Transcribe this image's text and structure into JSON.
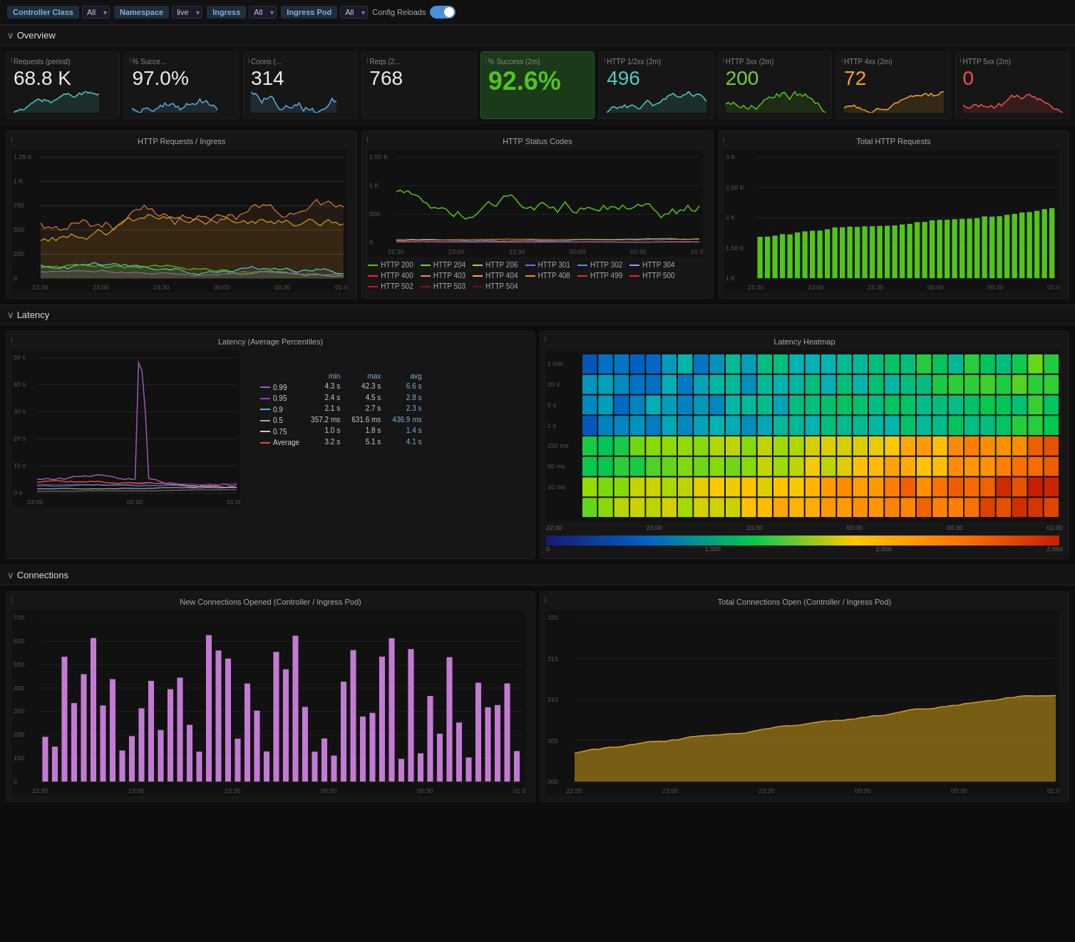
{
  "topbar": {
    "filters": [
      {
        "label": "Controller Class",
        "value": "All"
      },
      {
        "label": "Namespace",
        "value": "live"
      },
      {
        "label": "Ingress",
        "value": "All"
      },
      {
        "label": "Ingress Pod",
        "value": "All"
      }
    ],
    "config_reloads_label": "Config Reloads",
    "toggle_state": true
  },
  "overview": {
    "section_label": "Overview",
    "stats": [
      {
        "id": "requests-period",
        "title": "Requests (period)",
        "value": "68.8 K",
        "color": "white"
      },
      {
        "id": "pct-success",
        "title": "% Succe...",
        "value": "97.0%",
        "color": "white"
      },
      {
        "id": "conns",
        "title": "Conns (...",
        "value": "314",
        "color": "white"
      },
      {
        "id": "reqs",
        "title": "Reqs (2...",
        "value": "768",
        "color": "white"
      },
      {
        "id": "pct-success-2m",
        "title": "% Success (2m)",
        "value": "92.6%",
        "color": "big-green",
        "highlight": true
      },
      {
        "id": "http-12xx",
        "title": "HTTP 1/2xx (2m)",
        "value": "496",
        "color": "cyan"
      },
      {
        "id": "http-3xx",
        "title": "HTTP 3xx (2m)",
        "value": "200",
        "color": "green"
      },
      {
        "id": "http-4xx",
        "title": "HTTP 4xx (2m)",
        "value": "72",
        "color": "orange"
      },
      {
        "id": "http-5xx",
        "title": "HTTP 5xx (2m)",
        "value": "0",
        "color": "red"
      }
    ]
  },
  "latency": {
    "section_label": "Latency",
    "percentiles": [
      {
        "label": "0.99",
        "color": "#9b59b6",
        "min": "4.3 s",
        "max": "42.3 s",
        "avg": "6.6 s"
      },
      {
        "label": "0.95",
        "color": "#8e44ad",
        "min": "2.4 s",
        "max": "4.5 s",
        "avg": "2.8 s"
      },
      {
        "label": "0.9",
        "color": "#5dade2",
        "min": "2.1 s",
        "max": "2.7 s",
        "avg": "2.3 s"
      },
      {
        "label": "0.5",
        "color": "#aaa",
        "min": "357.2 ms",
        "max": "631.6 ms",
        "avg": "436.9 ms"
      },
      {
        "label": "0.75",
        "color": "#ccc",
        "min": "1.0 s",
        "max": "1.8 s",
        "avg": "1.4 s"
      },
      {
        "label": "Average",
        "color": "#e74c3c",
        "min": "3.2 s",
        "max": "5.1 s",
        "avg": "4.1 s"
      }
    ]
  },
  "connections": {
    "section_label": "Connections",
    "new_connections_title": "New Connections Opened (Controller / Ingress Pod)",
    "total_connections_title": "Total Connections Open (Controller / Ingress Pod)"
  },
  "http_status_legend": [
    {
      "code": "HTTP 200",
      "color": "#52c41a"
    },
    {
      "code": "HTTP 204",
      "color": "#73d13d"
    },
    {
      "code": "HTTP 206",
      "color": "#95de64"
    },
    {
      "code": "HTTP 301",
      "color": "#597ef7"
    },
    {
      "code": "HTTP 302",
      "color": "#4096ff"
    },
    {
      "code": "HTTP 304",
      "color": "#85a5ff"
    },
    {
      "code": "HTTP 400",
      "color": "#f5222d"
    },
    {
      "code": "HTTP 403",
      "color": "#ff7875"
    },
    {
      "code": "HTTP 404",
      "color": "#ffa940"
    },
    {
      "code": "HTTP 408",
      "color": "#fa8c16"
    },
    {
      "code": "HTTP 499",
      "color": "#d4380d"
    },
    {
      "code": "HTTP 500",
      "color": "#f5222d"
    },
    {
      "code": "HTTP 502",
      "color": "#cf1322"
    },
    {
      "code": "HTTP 503",
      "color": "#a8071a"
    },
    {
      "code": "HTTP 504",
      "color": "#820014"
    }
  ],
  "time_labels": [
    "22:30",
    "23:00",
    "23:30",
    "00:00",
    "00:30",
    "01:00"
  ]
}
